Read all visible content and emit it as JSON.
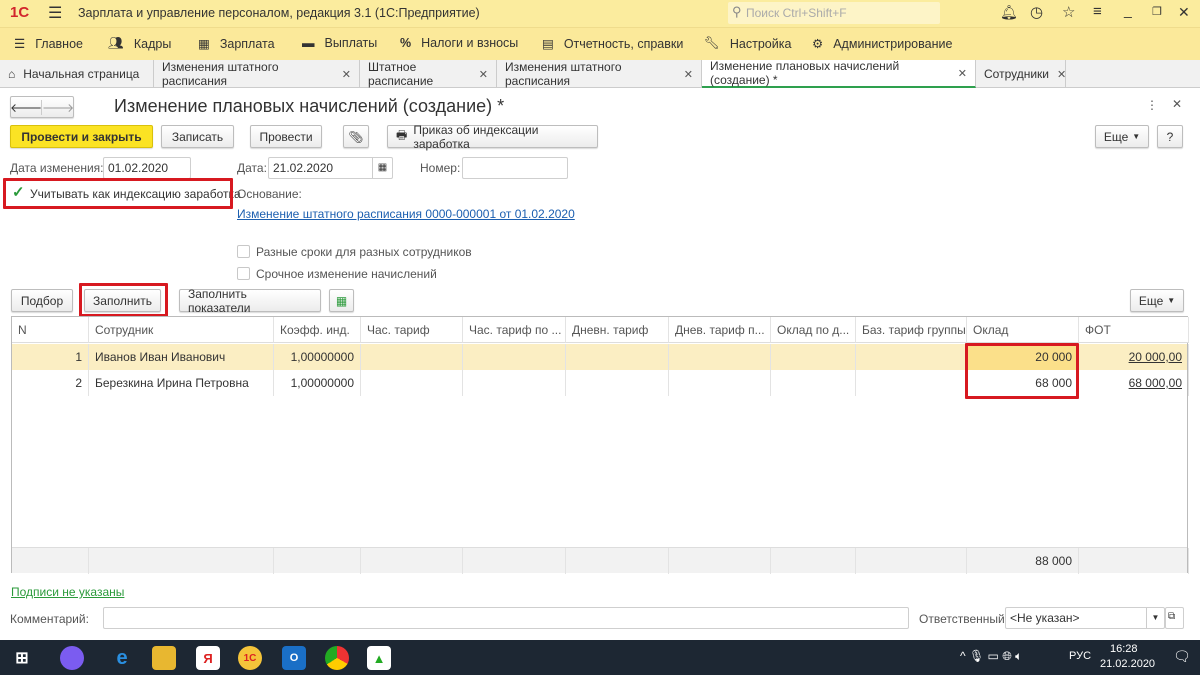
{
  "app": {
    "title": "Зарплата и управление персоналом, редакция 3.1  (1С:Предприятие)",
    "logo": "1С",
    "search_placeholder": "Поиск Ctrl+Shift+F"
  },
  "sections": [
    "Главное",
    "Кадры",
    "Зарплата",
    "Выплаты",
    "Налоги и взносы",
    "Отчетность, справки",
    "Настройка",
    "Администрирование"
  ],
  "tabs": [
    {
      "label": "Начальная страница"
    },
    {
      "label": "Изменения штатного расписания"
    },
    {
      "label": "Штатное расписание"
    },
    {
      "label": "Изменения штатного расписания"
    },
    {
      "label": "Изменение плановых начислений (создание) *"
    },
    {
      "label": "Сотрудники"
    }
  ],
  "form": {
    "title": "Изменение плановых начислений (создание) *",
    "buttons": {
      "post_close": "Провести и закрыть",
      "save": "Записать",
      "post": "Провести",
      "print": "Приказ об индексации заработка",
      "more": "Еще",
      "help": "?"
    },
    "change_date_label": "Дата изменения:",
    "change_date": "01.02.2020",
    "date_label": "Дата:",
    "date": "21.02.2020",
    "number_label": "Номер:",
    "number": "",
    "indexation_label": "Учитывать как индексацию заработка",
    "basis_label": "Основание:",
    "basis_link": "Изменение штатного расписания 0000-000001 от 01.02.2020",
    "diff_terms_label": "Разные сроки для разных сотрудников",
    "urgent_label": "Срочное изменение начислений",
    "table_buttons": {
      "pick": "Подбор",
      "fill": "Заполнить",
      "fill_indicators": "Заполнить показатели",
      "more": "Еще"
    },
    "columns": [
      "N",
      "Сотрудник",
      "Коэфф. инд.",
      "Час. тариф",
      "Час. тариф по ...",
      "Дневн. тариф",
      "Днев. тариф п...",
      "Оклад по д...",
      "Баз. тариф группы",
      "Оклад",
      "ФОТ"
    ],
    "rows": [
      [
        "1",
        "Иванов Иван Иванович",
        "1,00000000",
        "",
        "",
        "",
        "",
        "",
        "",
        "20 000",
        "20 000,00"
      ],
      [
        "2",
        "Березкина Ирина Петровна",
        "1,00000000",
        "",
        "",
        "",
        "",
        "",
        "",
        "68 000",
        "68 000,00"
      ]
    ],
    "total_salary": "88 000",
    "signatures_link": "Подписи не указаны",
    "comment_label": "Комментарий:",
    "comment": "",
    "responsible_label": "Ответственный:",
    "responsible": "<Не указан>"
  },
  "taskbar": {
    "lang": "РУС",
    "time": "16:28",
    "date": "21.02.2020"
  }
}
